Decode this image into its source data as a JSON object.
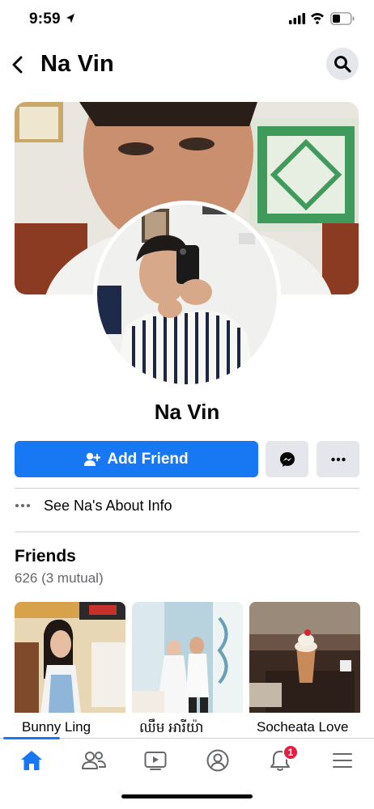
{
  "status_bar": {
    "time": "9:59"
  },
  "header": {
    "title": "Na Vin",
    "back_icon": "chevron-left-icon",
    "search_icon": "search-icon"
  },
  "profile": {
    "name": "Na Vin"
  },
  "actions": {
    "add_friend_label": "Add Friend",
    "add_friend_icon": "person-plus-icon",
    "messenger_icon": "messenger-icon",
    "more_icon": "more-horizontal-icon"
  },
  "about": {
    "label": "See Na's About Info"
  },
  "friends": {
    "title": "Friends",
    "count": "626 (3 mutual)",
    "items": [
      {
        "name": "Bunny Ling"
      },
      {
        "name": "ឈឹម អារីយ៉ា"
      },
      {
        "name": "Socheata Love"
      }
    ]
  },
  "tab_bar": {
    "tabs": [
      "home-icon",
      "friends-icon",
      "watch-icon",
      "profile-icon",
      "notifications-icon",
      "menu-icon"
    ],
    "notification_badge": "1"
  },
  "colors": {
    "accent": "#1877f2",
    "secondary_button": "#e4e6eb",
    "badge": "#e41e3f",
    "text_secondary": "#65676b"
  }
}
